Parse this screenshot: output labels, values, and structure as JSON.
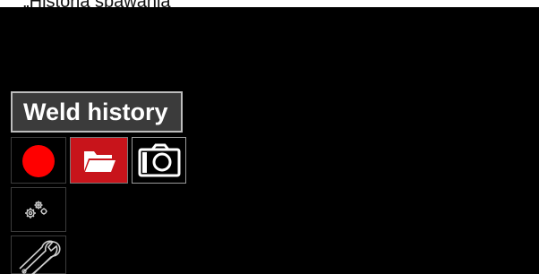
{
  "caption": "„Historia spawania",
  "screen": {
    "title": "Weld history",
    "tiles": [
      {
        "icon": "record-icon",
        "label_name": "record-tile",
        "color": "#ff0000"
      },
      {
        "icon": "folder-icon",
        "label_name": "folder-tile",
        "selected": true,
        "color": "#c8141b"
      },
      {
        "icon": "camera-icon",
        "label_name": "camera-tile"
      },
      {
        "icon": "gears-icon",
        "label_name": "settings-tile"
      },
      {
        "icon": "wrench-icon",
        "label_name": "service-tile"
      }
    ]
  }
}
